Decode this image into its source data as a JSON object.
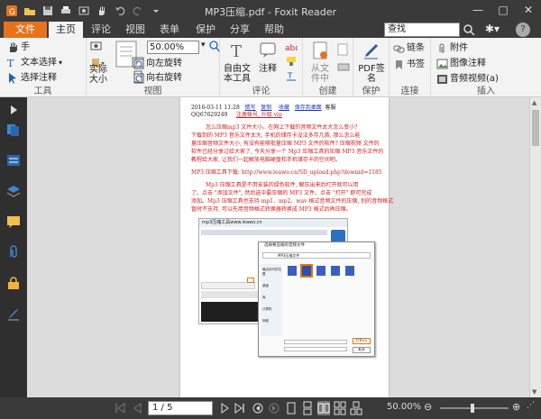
{
  "window": {
    "title": "MP3压缩.pdf - Foxit Reader"
  },
  "tabs": [
    {
      "label": "文件"
    },
    {
      "label": "主页"
    },
    {
      "label": "评论"
    },
    {
      "label": "视图"
    },
    {
      "label": "表单"
    },
    {
      "label": "保护"
    },
    {
      "label": "分享"
    },
    {
      "label": "帮助"
    }
  ],
  "search": {
    "placeholder": "查找"
  },
  "ribbon": {
    "tools": {
      "hand": "手",
      "select_text": "文本选择",
      "select_annotation": "选择注释",
      "label": "工具"
    },
    "view": {
      "actual_size": "实际\n大小",
      "zoom": "50.00%",
      "rotate_left": "向左旋转",
      "rotate_right": "向右旋转",
      "label": "视图"
    },
    "comment": {
      "text_comment": "自由文\n本工具",
      "note": "注释",
      "label": "评论"
    },
    "create": {
      "from_file": "从文\n件中",
      "label": "创建"
    },
    "protect": {
      "pdf_sign": "PDF签\n名",
      "label": "保护"
    },
    "link": {
      "link": "链条",
      "bookmark": "书签",
      "label": "连接"
    },
    "insert": {
      "attachment": "附件",
      "image_annotation": "图像注释",
      "audio_video": "音频视频(a)",
      "label": "插入"
    }
  },
  "document": {
    "header": {
      "date": "2016-03-11 11:28",
      "link1": "撰写",
      "link2": "复制",
      "link3": "收藏",
      "link4": "保存到桌面",
      "tag": "客服",
      "id": "QQ67629249",
      "note": "注册帐号, 升级 vip"
    },
    "para1": [
      "怎么压缩mp3 文件大小。在网上下载的音频文件太大怎么变小?",
      "下载到的 MP3 音乐文件太大, 手机的储存卡没法多存几首, 那么怎么能",
      "量压缩音频文件大小, 有没有能够批量压缩 MP3 文件的软件? 压缩视频 文件的",
      "软件已经分享过给大家了, 今天分享一个 Mp3 压缩工具的压缩 MP3 音乐文件的",
      "教程给大家, 让我们一起解放电脑硬盘和手机储存卡的空间吧。"
    ],
    "download": "MP3 压缩工具下载: http://www.leawo.cn/SD_upload.php?downid=1185",
    "para2": [
      "Mp3 压缩工具是不用安装的绿色软件, 解压出来后打开就可以用",
      "了。点击 \"添加文件\", 然后选中要压缩的 MP3 文件。点击 \"打开\" 即可完成",
      "添加。Mp3 压缩工具也支持 mp1、mp2、wav 格式音频文件的压缩, 别的音频格式",
      "暂时不支持, 可以先用音频格式转换器转换成 MP3 格式后再压缩。"
    ],
    "shot_title": "mp3压缩工具www.leawo.cn",
    "dialog_title": "选择要压缩的音频文件",
    "dialog_path": "MP3压缩文件",
    "open_btn": "打开(O)",
    "cancel_btn": "取消",
    "sidebar_items": [
      "最近访问的位置",
      "桌面",
      "库",
      "计算机",
      "网络"
    ]
  },
  "status": {
    "page": "1 / 5",
    "zoom": "50.00%"
  },
  "colors": {
    "accent": "#e6731b",
    "chrome": "#3a3a3a",
    "ribbon": "#f3f3f3"
  }
}
